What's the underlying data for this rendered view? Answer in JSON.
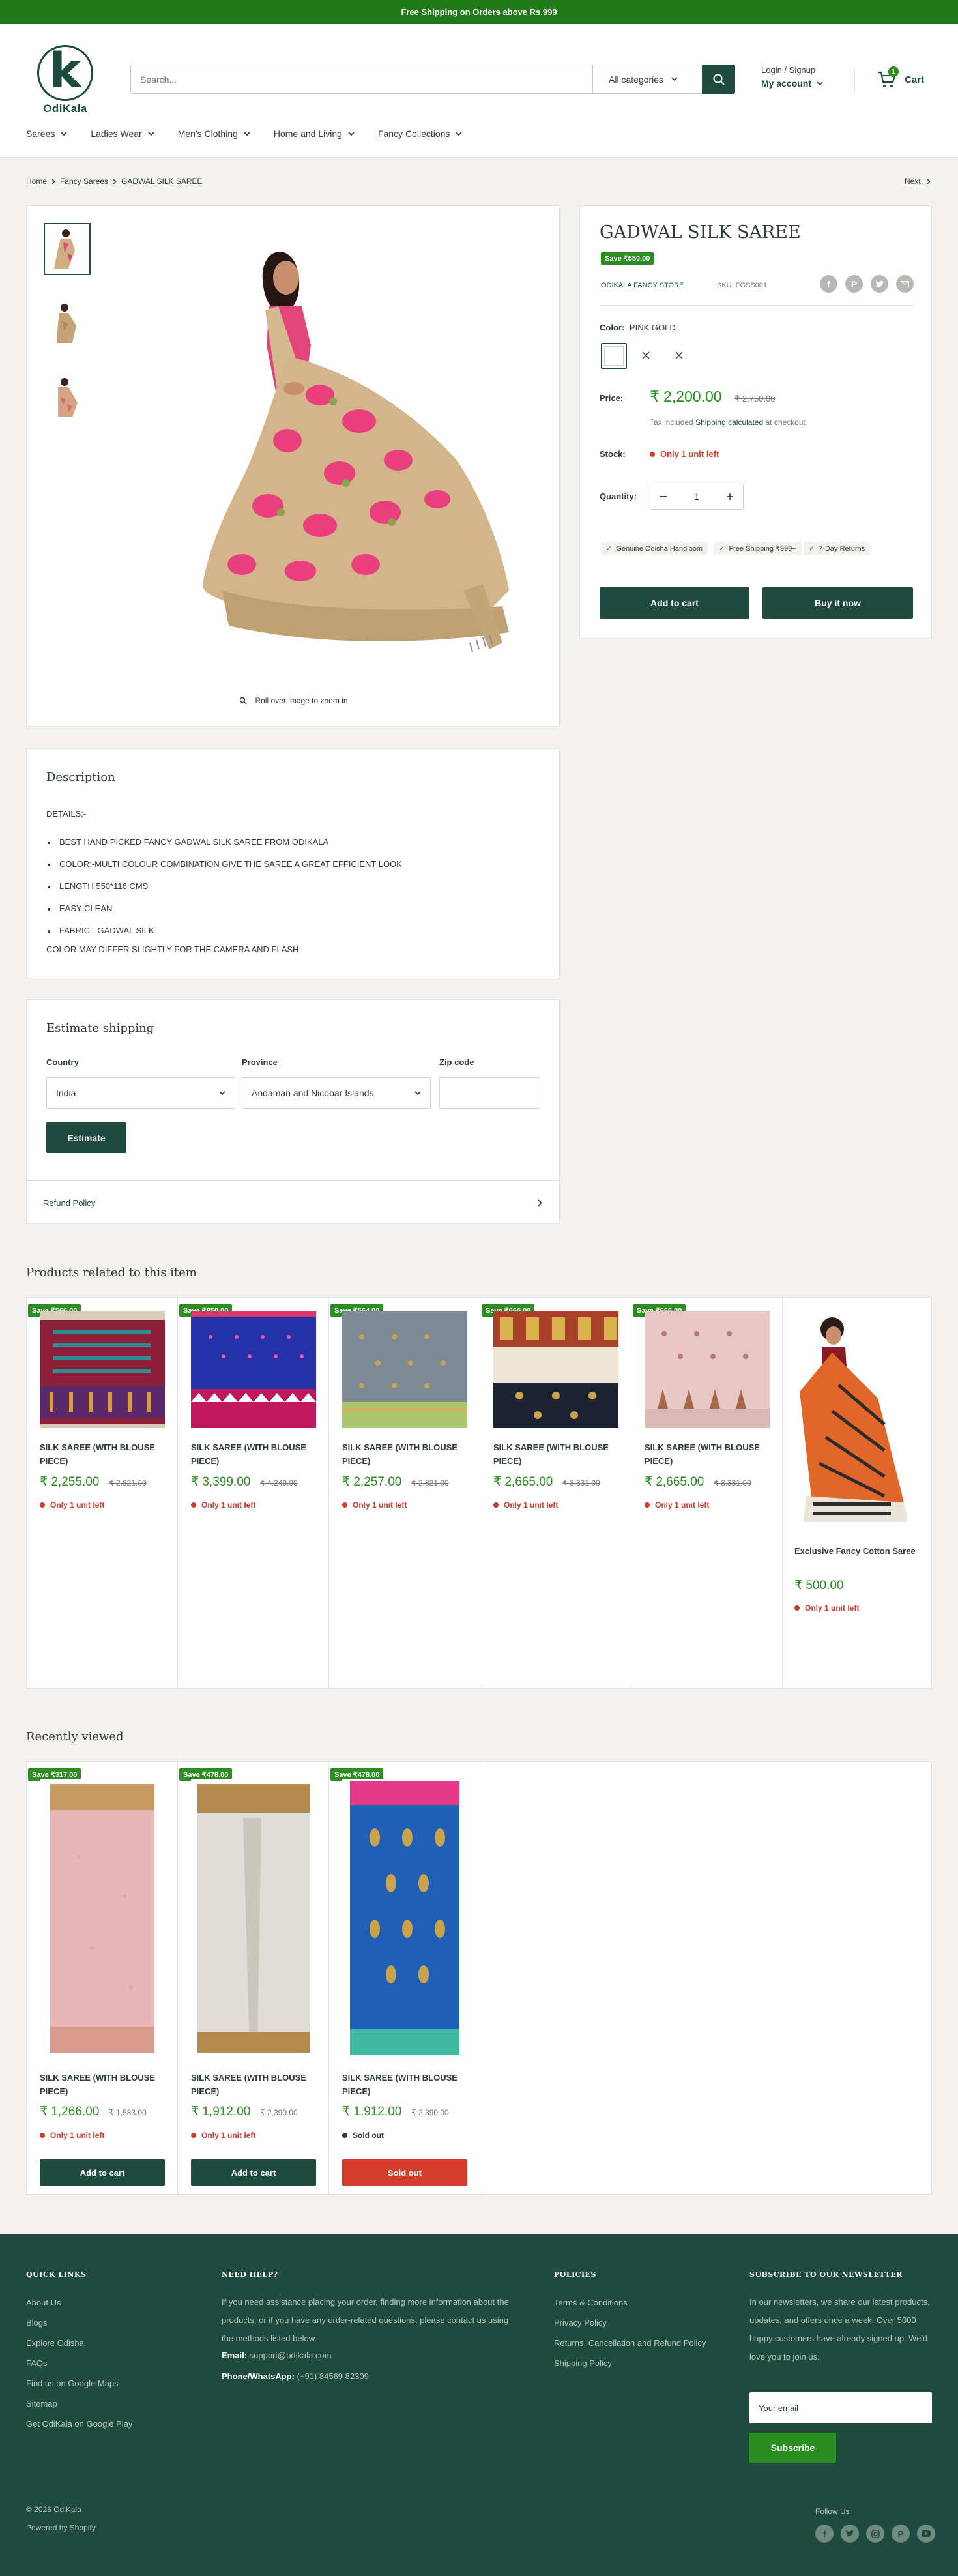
{
  "announcement": "Free Shipping on Orders above Rs.999",
  "brand": {
    "name": "OdiKala",
    "letter": "k"
  },
  "search": {
    "placeholder": "Search...",
    "category": "All categories"
  },
  "account": {
    "login": "Login / Signup",
    "my_account": "My account"
  },
  "cart": {
    "label": "Cart",
    "count": "1"
  },
  "nav": [
    "Sarees",
    "Ladies Wear",
    "Men's Clothing",
    "Home and Living",
    "Fancy Collections"
  ],
  "breadcrumb": {
    "home": "Home",
    "collection": "Fancy Sarees",
    "current": "GADWAL SILK SAREE",
    "next": "Next"
  },
  "gallery": {
    "zoom_hint": "Roll over image to zoom in"
  },
  "product": {
    "title": "GADWAL SILK SAREE",
    "save": "Save ₹550.00",
    "vendor": "ODIKALA FANCY STORE",
    "sku": "SKU: FGSS001",
    "color_label": "Color:",
    "color_value": "PINK GOLD",
    "price_label": "Price:",
    "price": "₹ 2,200.00",
    "compare_price": "₹ 2,750.00",
    "tax_prefix": "Tax included",
    "tax_link": "Shipping calculated",
    "tax_suffix": "at checkout",
    "stock_label": "Stock:",
    "stock_value": "Only 1 unit left",
    "qty_label": "Quantity:",
    "qty_value": "1",
    "tags": [
      "Genuine Odisha Handloom",
      "Free Shipping ₹999+",
      "7-Day Returns"
    ],
    "add_to_cart": "Add to cart",
    "buy_now": "Buy it now"
  },
  "description": {
    "title": "Description",
    "details": "DETAILS:-",
    "bullets": [
      "BEST HAND PICKED FANCY GADWAL SILK SAREE  FROM ODIKALA",
      "COLOR:-MULTI COLOUR COMBINATION GIVE THE SAREE A GREAT EFFICIENT LOOK",
      "LENGTH 550*116 CMS",
      "EASY CLEAN",
      "FABRIC:-  GADWAL SILK"
    ],
    "note": "COLOR MAY DIFFER SLIGHTLY FOR THE CAMERA AND FLASH"
  },
  "shipping": {
    "title": "Estimate shipping",
    "country_label": "Country",
    "country_value": "India",
    "province_label": "Province",
    "province_value": "Andaman and Nicobar Islands",
    "zip_label": "Zip code",
    "button": "Estimate",
    "refund": "Refund Policy"
  },
  "related": {
    "title": "Products related to this item",
    "items": [
      {
        "save": "Save ₹566.00",
        "name": "SILK SAREE (WITH BLOUSE PIECE)",
        "price": "₹ 2,255.00",
        "compare": "₹ 2,821.00",
        "stock": "Only 1 unit left"
      },
      {
        "save": "Save ₹850.00",
        "name": "SILK SAREE (WITH BLOUSE PIECE)",
        "price": "₹ 3,399.00",
        "compare": "₹ 4,249.00",
        "stock": "Only 1 unit left"
      },
      {
        "save": "Save ₹564.00",
        "name": "SILK SAREE (WITH BLOUSE PIECE)",
        "price": "₹ 2,257.00",
        "compare": "₹ 2,821.00",
        "stock": "Only 1 unit left"
      },
      {
        "save": "Save ₹666.00",
        "name": "SILK SAREE (WITH BLOUSE PIECE)",
        "price": "₹ 2,665.00",
        "compare": "₹ 3,331.00",
        "stock": "Only 1 unit left"
      },
      {
        "save": "Save ₹666.00",
        "name": "SILK SAREE (WITH BLOUSE PIECE)",
        "price": "₹ 2,665.00",
        "compare": "₹ 3,331.00",
        "stock": "Only 1 unit left"
      },
      {
        "save": "",
        "name": "Exclusive Fancy Cotton Saree",
        "price": "₹ 500.00",
        "compare": "",
        "stock": "Only 1 unit left"
      }
    ]
  },
  "recent": {
    "title": "Recently viewed",
    "items": [
      {
        "save": "Save ₹317.00",
        "name": "SILK SAREE (WITH BLOUSE PIECE)",
        "price": "₹ 1,266.00",
        "compare": "₹ 1,583.00",
        "stock": "Only 1 unit left",
        "button": "Add to cart"
      },
      {
        "save": "Save ₹478.00",
        "name": "SILK SAREE (WITH BLOUSE PIECE)",
        "price": "₹ 1,912.00",
        "compare": "₹ 2,390.00",
        "stock": "Only 1 unit left",
        "button": "Add to cart"
      },
      {
        "save": "Save ₹478.00",
        "name": "SILK SAREE (WITH BLOUSE PIECE)",
        "price": "₹ 1,912.00",
        "compare": "₹ 2,390.00",
        "stock": "Sold out",
        "button": "Sold out"
      }
    ]
  },
  "footer": {
    "quick_title": "QUICK LINKS",
    "quick_links": [
      "About Us",
      "Blogs",
      "Explore Odisha",
      "FAQs",
      "Find us on Google Maps",
      "Sitemap",
      "Get OdiKala on Google Play"
    ],
    "help_title": "NEED HELP?",
    "help_text": "If you need assistance placing your order, finding more information about the products, or if you have any order-related questions, please contact us using the methods listed below.",
    "email_label": "Email:",
    "email_value": "support@odikala.com",
    "phone_label": "Phone/WhatsApp:",
    "phone_value": "(+91) 84569 82309",
    "policies_title": "POLICIES",
    "policies": [
      "Terms & Conditions",
      "Privacy Policy",
      "Returns, Cancellation and Refund Policy",
      "Shipping Policy"
    ],
    "newsletter_title": "SUBSCRIBE TO OUR NEWSLETTER",
    "newsletter_text": "In our newsletters, we share our latest products, updates, and offers once a week. Over 5000 happy customers have already signed up. We'd love you to join us.",
    "email_placeholder": "Your email",
    "subscribe": "Subscribe",
    "copyright": "© 2026 OdiKala",
    "powered": "Powered by Shopify",
    "follow": "Follow Us"
  },
  "colors": {
    "brand_dark": "#1e4b3e",
    "brand_green": "#2a8d1f",
    "alert_red": "#d33b2c",
    "footer_bg": "#1e4b3e"
  }
}
